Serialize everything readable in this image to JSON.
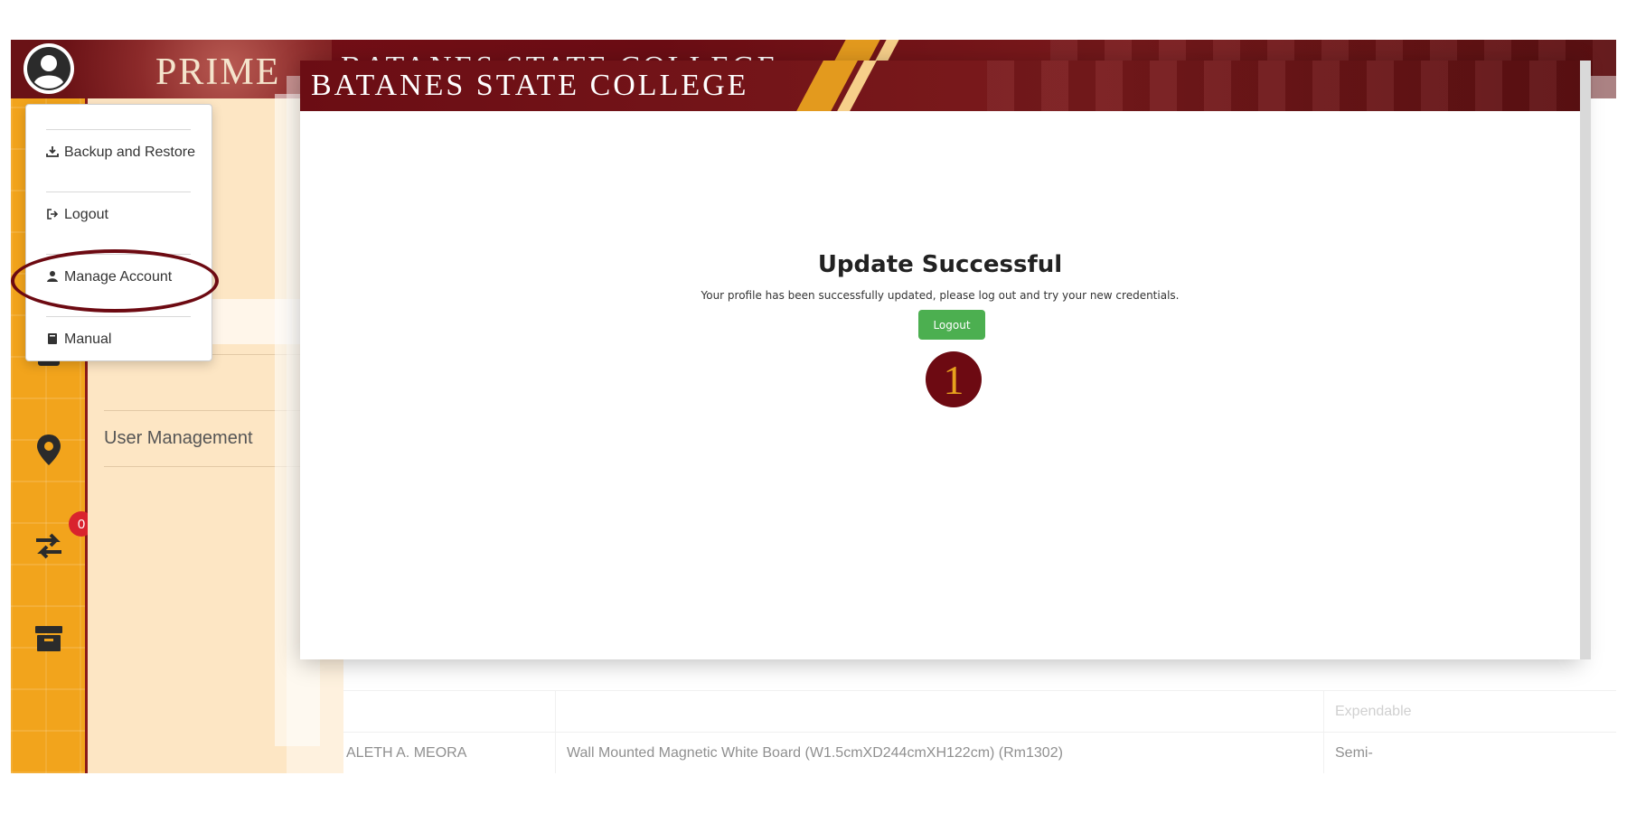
{
  "header": {
    "brand_logo": "PRIME",
    "college_name": "BATANES STATE COLLEGE"
  },
  "rail": {
    "notification_count": "0"
  },
  "sidebar": {
    "user_management": "User Management"
  },
  "user_menu": {
    "items": [
      {
        "label": "Backup and Restore",
        "icon": "download-icon"
      },
      {
        "label": "Logout",
        "icon": "sign-out-icon"
      },
      {
        "label": "Manage Account",
        "icon": "user-icon"
      },
      {
        "label": "Manual",
        "icon": "book-icon"
      }
    ]
  },
  "modal": {
    "college_name": "BATANES STATE COLLEGE",
    "title": "Update Successful",
    "message": "Your profile has been successfully updated, please log out and try your new credentials.",
    "logout_label": "Logout",
    "step_number": "1"
  },
  "table": {
    "rows": [
      {
        "name": "",
        "item": "",
        "type": "Expendable"
      },
      {
        "name": "ALETH A. MEORA",
        "item": "Wall Mounted Magnetic White Board (W1.5cmXD244cmXH122cm) (Rm1302)",
        "type": "Semi-"
      }
    ]
  },
  "colors": {
    "maroon": "#6d0a12",
    "gold": "#f2a41c",
    "green": "#4caf50",
    "badge_red": "#d9232d"
  }
}
